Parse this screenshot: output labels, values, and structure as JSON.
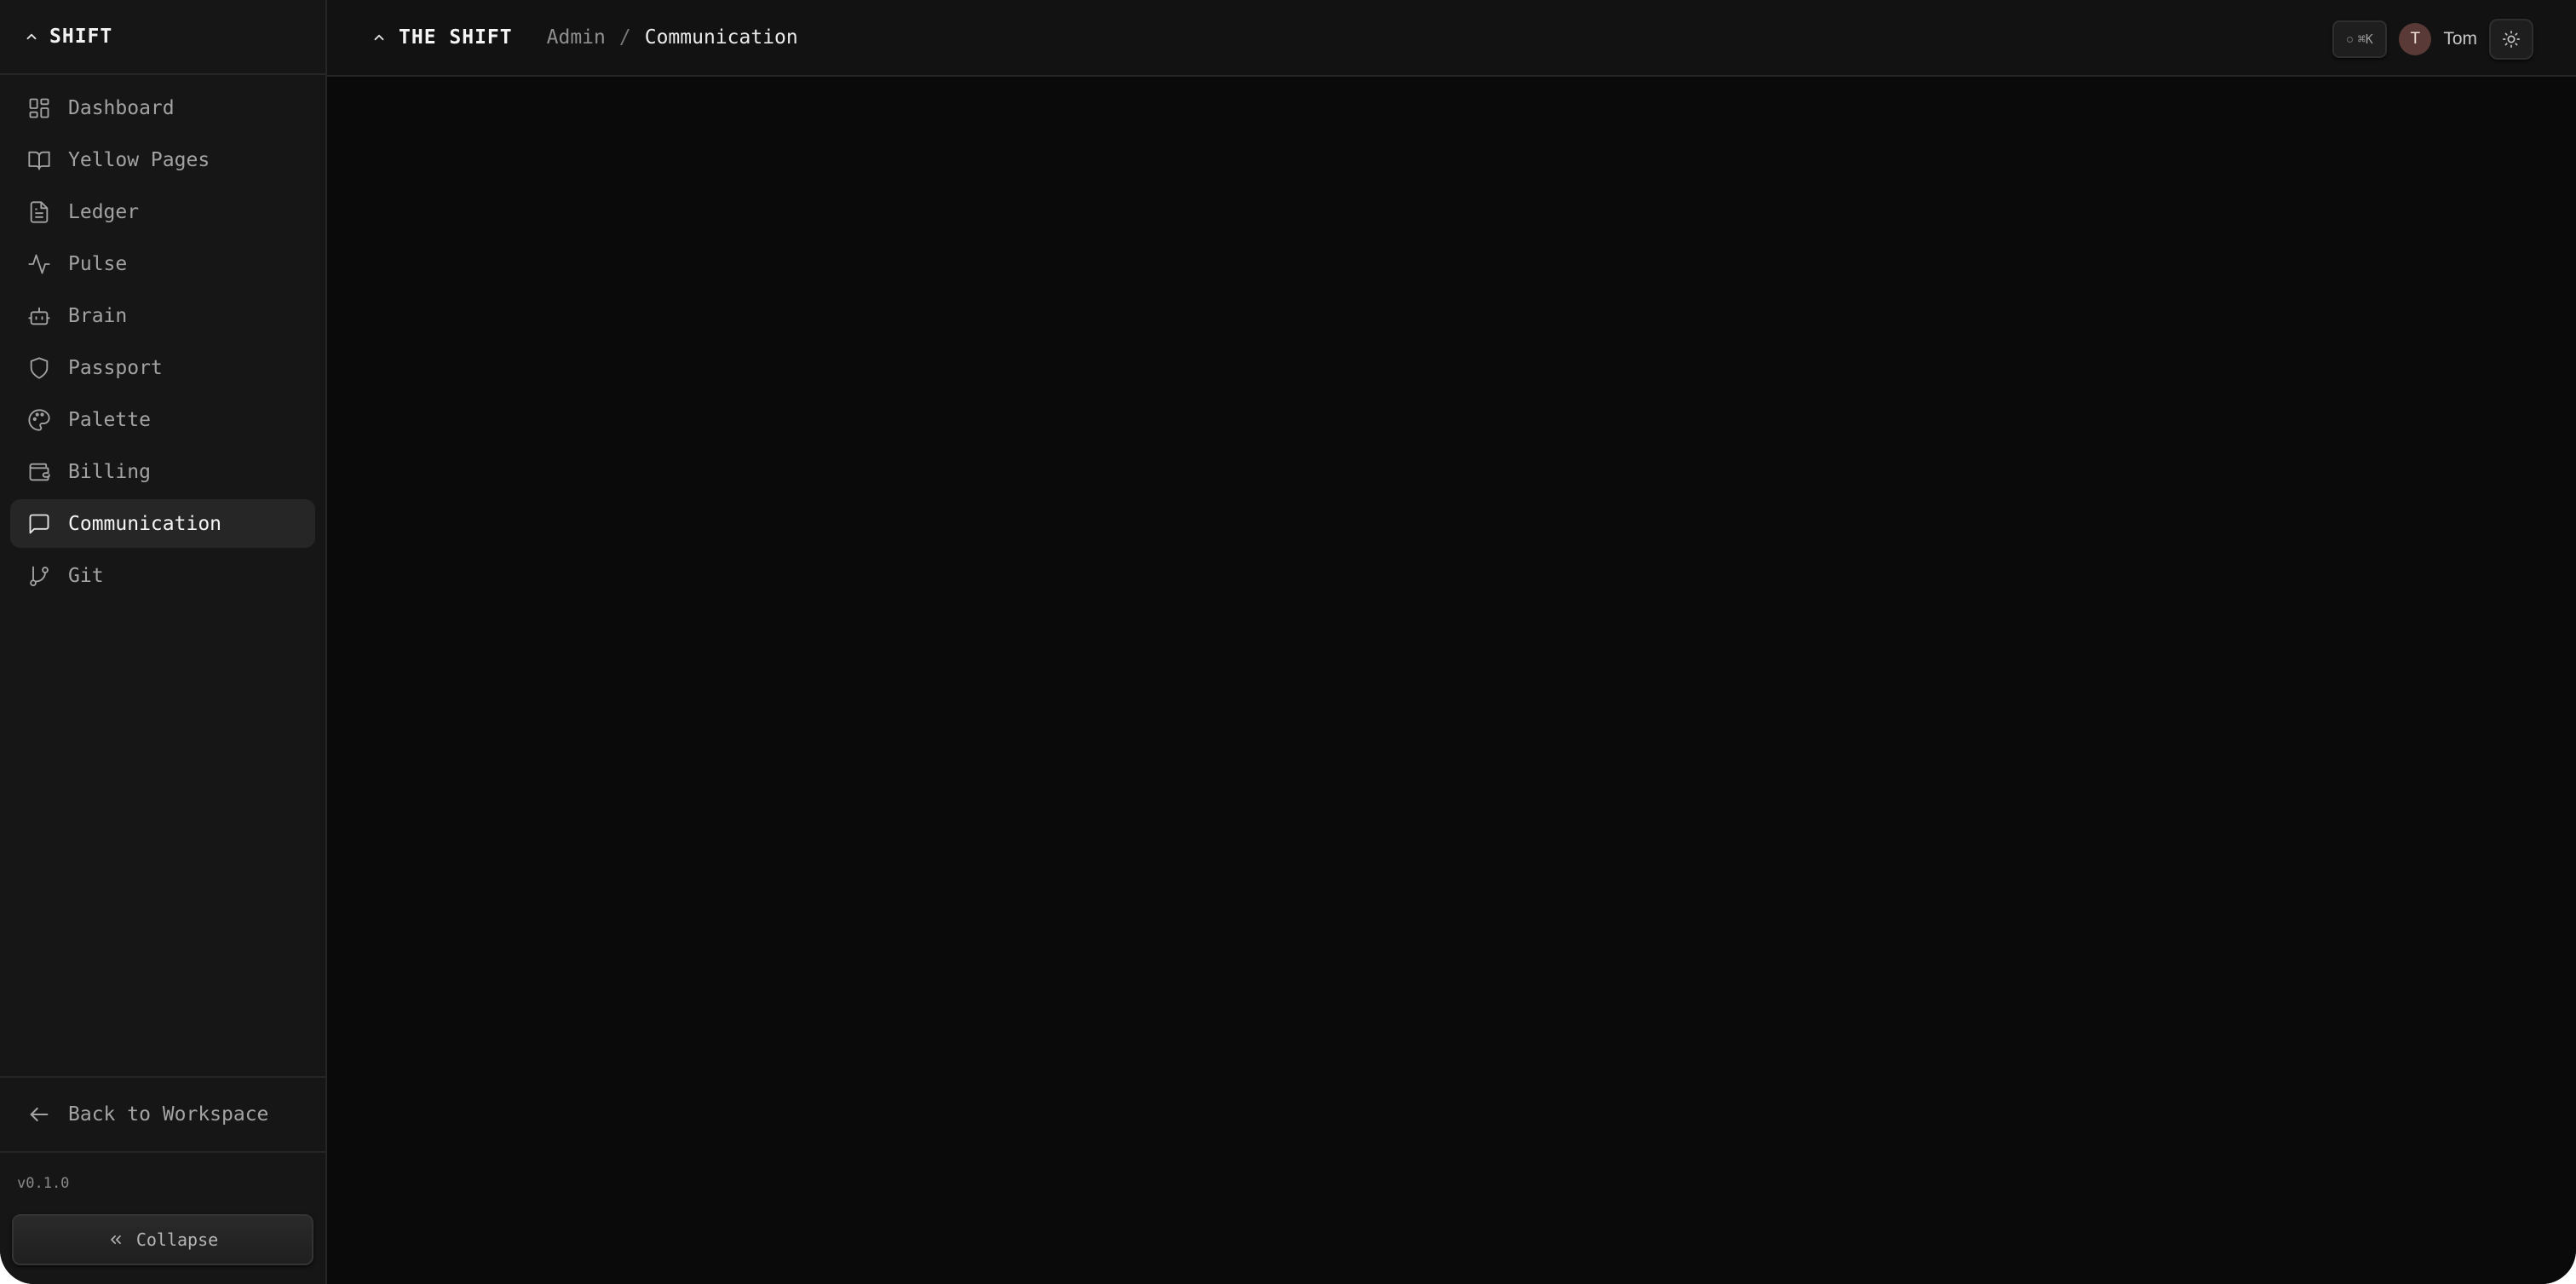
{
  "sidebar": {
    "brand": "SHIFT",
    "items": [
      {
        "label": "Dashboard",
        "icon": "dashboard-icon"
      },
      {
        "label": "Yellow Pages",
        "icon": "book-icon"
      },
      {
        "label": "Ledger",
        "icon": "document-icon"
      },
      {
        "label": "Pulse",
        "icon": "activity-icon"
      },
      {
        "label": "Brain",
        "icon": "robot-icon"
      },
      {
        "label": "Passport",
        "icon": "shield-icon"
      },
      {
        "label": "Palette",
        "icon": "palette-icon"
      },
      {
        "label": "Billing",
        "icon": "wallet-icon"
      },
      {
        "label": "Communication",
        "icon": "message-icon",
        "active": true
      },
      {
        "label": "Git",
        "icon": "git-branch-icon"
      }
    ],
    "back_label": "Back to Workspace",
    "version": "v0.1.0",
    "collapse_label": "Collapse"
  },
  "header": {
    "org": "THE SHIFT",
    "breadcrumb": [
      "Admin",
      "Communication"
    ],
    "separator": "/",
    "shortcut": "⌘K",
    "avatar_initial": "T",
    "user_name": "Tom"
  },
  "colors": {
    "background": "#0a0a0a",
    "sidebar": "#161616",
    "active_item": "#262626",
    "avatar": "#5a3a36"
  }
}
